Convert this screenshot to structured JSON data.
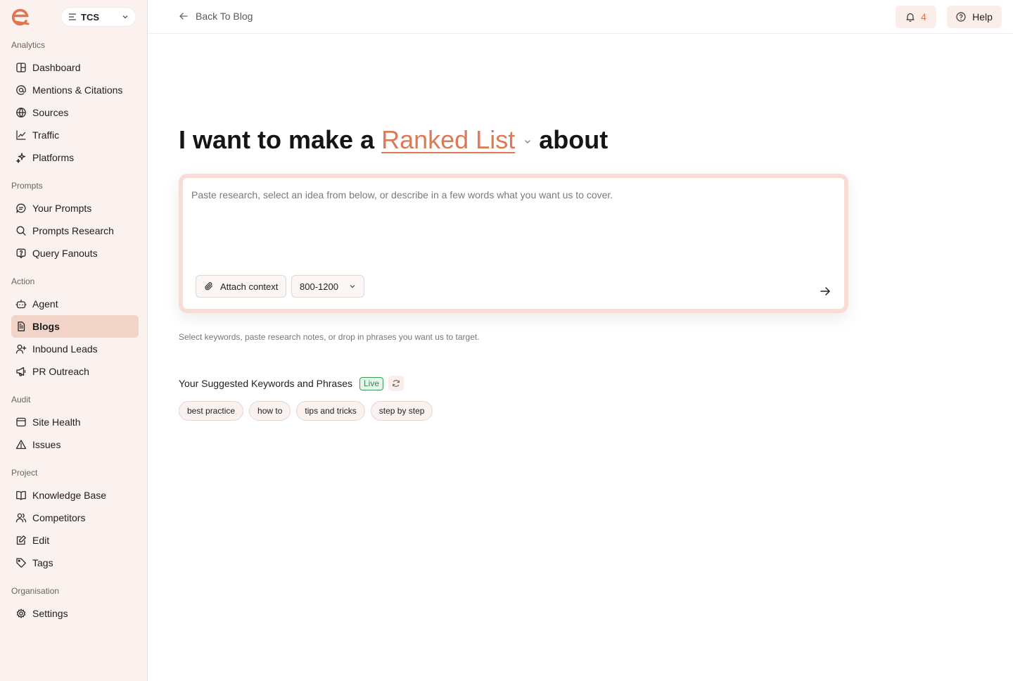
{
  "colors": {
    "accent": "#db7a54",
    "sidebar_bg": "#fbf1ee",
    "active_item": "#f2d3c8",
    "live_green": "#2d8c4e"
  },
  "workspace": {
    "name": "TCS"
  },
  "sidebar": {
    "sections": [
      {
        "title": "Analytics",
        "items": [
          {
            "label": "Dashboard",
            "icon": "layout-icon"
          },
          {
            "label": "Mentions & Citations",
            "icon": "at-sign-icon"
          },
          {
            "label": "Sources",
            "icon": "globe-icon"
          },
          {
            "label": "Traffic",
            "icon": "line-chart-icon"
          },
          {
            "label": "Platforms",
            "icon": "sparkles-icon"
          }
        ]
      },
      {
        "title": "Prompts",
        "items": [
          {
            "label": "Your Prompts",
            "icon": "message-icon"
          },
          {
            "label": "Prompts Research",
            "icon": "search-icon"
          },
          {
            "label": "Query Fanouts",
            "icon": "help-message-icon"
          }
        ]
      },
      {
        "title": "Action",
        "items": [
          {
            "label": "Agent",
            "icon": "bot-icon"
          },
          {
            "label": "Blogs",
            "icon": "document-icon",
            "active": true
          },
          {
            "label": "Inbound Leads",
            "icon": "user-plus-icon"
          },
          {
            "label": "PR Outreach",
            "icon": "megaphone-icon"
          }
        ]
      },
      {
        "title": "Audit",
        "items": [
          {
            "label": "Site Health",
            "icon": "browser-icon"
          },
          {
            "label": "Issues",
            "icon": "warning-icon"
          }
        ]
      },
      {
        "title": "Project",
        "items": [
          {
            "label": "Knowledge Base",
            "icon": "book-icon"
          },
          {
            "label": "Competitors",
            "icon": "users-icon"
          },
          {
            "label": "Edit",
            "icon": "edit-icon"
          },
          {
            "label": "Tags",
            "icon": "tag-icon"
          }
        ]
      },
      {
        "title": "Organisation",
        "items": [
          {
            "label": "Settings",
            "icon": "gear-icon"
          }
        ]
      }
    ]
  },
  "header": {
    "back_label": "Back To Blog",
    "notification_count": "4",
    "help_label": "Help"
  },
  "main": {
    "headline_prefix": "I want to make a",
    "content_type": "Ranked List",
    "headline_suffix": "about",
    "composer": {
      "placeholder": "Paste research, select an idea from below, or describe in a few words what you want us to cover.",
      "attach_label": "Attach context",
      "length_value": "800-1200"
    },
    "helper_text": "Select keywords, paste research notes, or drop in phrases you want us to target.",
    "keywords": {
      "title": "Your Suggested Keywords and Phrases",
      "badge": "Live",
      "chips": [
        "best practice",
        "how to",
        "tips and tricks",
        "step by step"
      ]
    }
  }
}
